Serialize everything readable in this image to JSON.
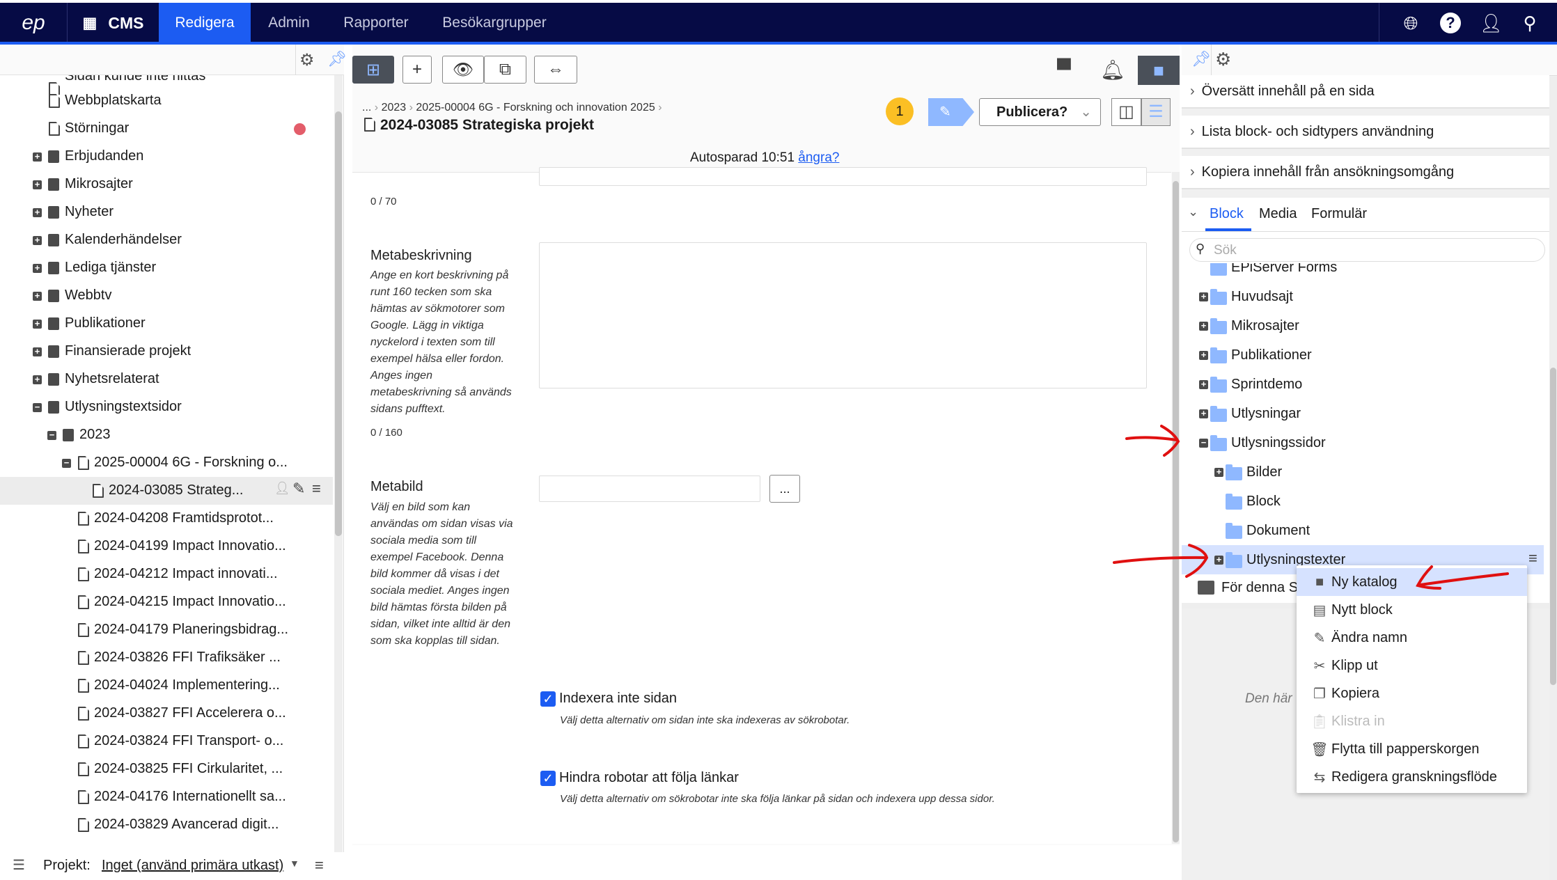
{
  "nav": {
    "logo": "epi",
    "product": "CMS",
    "tabs": [
      {
        "label": "Redigera",
        "active": true
      },
      {
        "label": "Admin"
      },
      {
        "label": "Rapporter"
      },
      {
        "label": "Besökargrupper"
      }
    ],
    "icons": [
      "globe-icon",
      "help-icon",
      "user-icon",
      "search-icon"
    ],
    "accent": "#1c5cf2",
    "background": "#060b45"
  },
  "left_tree": {
    "items": [
      {
        "label": "Sidan kunde inte hittas",
        "level": 0,
        "icon": "page"
      },
      {
        "label": "Webbplatskarta",
        "level": 0,
        "icon": "page"
      },
      {
        "label": "Störningar",
        "level": 0,
        "icon": "page",
        "badge": "clock"
      },
      {
        "label": "Erbjudanden",
        "level": 0,
        "icon": "stack",
        "toggle": "+"
      },
      {
        "label": "Mikrosajter",
        "level": 0,
        "icon": "stack",
        "toggle": "+"
      },
      {
        "label": "Nyheter",
        "level": 0,
        "icon": "stack",
        "toggle": "+"
      },
      {
        "label": "Kalenderhändelser",
        "level": 0,
        "icon": "stack",
        "toggle": "+"
      },
      {
        "label": "Lediga tjänster",
        "level": 0,
        "icon": "stack",
        "toggle": "+"
      },
      {
        "label": "Webbtv",
        "level": 0,
        "icon": "stack",
        "toggle": "+"
      },
      {
        "label": "Publikationer",
        "level": 0,
        "icon": "stack",
        "toggle": "+"
      },
      {
        "label": "Finansierade projekt",
        "level": 0,
        "icon": "stack",
        "toggle": "+"
      },
      {
        "label": "Nyhetsrelaterat",
        "level": 0,
        "icon": "stack",
        "toggle": "+"
      },
      {
        "label": "Utlysningstextsidor",
        "level": 0,
        "icon": "stack",
        "toggle": "-"
      },
      {
        "label": "2023",
        "level": 1,
        "icon": "stack",
        "toggle": "-"
      },
      {
        "label": "2025-00004 6G - Forskning o...",
        "level": 2,
        "icon": "page",
        "toggle": "-"
      },
      {
        "label": "2024-03085 Strateg...",
        "level": 3,
        "icon": "page",
        "selected": true
      },
      {
        "label": "2024-04208 Framtidsprotot...",
        "level": 2,
        "icon": "page"
      },
      {
        "label": "2024-04199 Impact Innovatio...",
        "level": 2,
        "icon": "page"
      },
      {
        "label": "2024-04212 Impact innovati...",
        "level": 2,
        "icon": "page"
      },
      {
        "label": "2024-04215 Impact Innovatio...",
        "level": 2,
        "icon": "page"
      },
      {
        "label": "2024-04179 Planeringsbidrag...",
        "level": 2,
        "icon": "page"
      },
      {
        "label": "2024-03826 FFI Trafiksäker ...",
        "level": 2,
        "icon": "page"
      },
      {
        "label": "2024-04024 Implementering...",
        "level": 2,
        "icon": "page"
      },
      {
        "label": "2024-03827 FFI Accelerera o...",
        "level": 2,
        "icon": "page"
      },
      {
        "label": "2024-03824 FFI Transport- o...",
        "level": 2,
        "icon": "page"
      },
      {
        "label": "2024-03825 FFI Cirkularitet, ...",
        "level": 2,
        "icon": "page"
      },
      {
        "label": "2024-04176 Internationellt sa...",
        "level": 2,
        "icon": "page"
      },
      {
        "label": "2024-03829 Avancerad digit...",
        "level": 2,
        "icon": "page"
      }
    ]
  },
  "status_bar": {
    "label": "Projekt:",
    "value": "Inget (använd primära utkast)"
  },
  "editor": {
    "breadcrumb": [
      "...",
      "2023",
      "2025-00004 6G - Forskning och innovation 2025"
    ],
    "title": "2024-03085 Strategiska projekt",
    "notification_count": "1",
    "publish_label": "Publicera?",
    "autosave_text": "Autosparad 10:51",
    "undo_link": "ångra?",
    "title_count": "0 / 70",
    "meta_description": {
      "label": "Metabeskrivning",
      "help": [
        "Ange en kort beskrivning på",
        "runt 160 tecken som ska",
        "hämtas av sökmotorer som",
        "Google. Lägg in viktiga",
        "nyckelord i texten som till",
        "exempel hälsa eller fordon.",
        "Anges ingen",
        "metabeskrivning så används",
        "sidans pufftext."
      ],
      "count": "0 / 160",
      "value": ""
    },
    "meta_image": {
      "label": "Metabild",
      "help": [
        "Välj en bild som kan",
        "användas om sidan visas via",
        "sociala media som till",
        "exempel Facebook. Denna",
        "bild kommer då visas i det",
        "sociala mediet. Anges ingen",
        "bild hämtas första bilden på",
        "sidan, vilket inte alltid är den",
        "som ska kopplas till sidan."
      ],
      "browse_label": "...",
      "value": ""
    },
    "noindex": {
      "label": "Indexera inte sidan",
      "help": "Välj detta alternativ om sidan inte ska indexeras av sökrobotar.",
      "checked": true
    },
    "nofollow": {
      "label": "Hindra robotar att följa länkar",
      "help": "Välj detta alternativ om sökrobotar inte ska följa länkar på sidan och indexera upp dessa sidor.",
      "checked": true
    }
  },
  "right_panel": {
    "sections": [
      "Översätt innehåll på en sida",
      "Lista block- och sidtypers användning",
      "Kopiera innehåll från ansökningsomgång"
    ],
    "tabs": [
      {
        "label": "Block",
        "active": true
      },
      {
        "label": "Media"
      },
      {
        "label": "Formulär"
      }
    ],
    "search_placeholder": "Sök",
    "tree": [
      {
        "label": "EPiServer Forms",
        "level": 0
      },
      {
        "label": "Huvudsajt",
        "level": 0,
        "toggle": "+"
      },
      {
        "label": "Mikrosajter",
        "level": 0,
        "toggle": "+"
      },
      {
        "label": "Publikationer",
        "level": 0,
        "toggle": "+"
      },
      {
        "label": "Sprintdemo",
        "level": 0,
        "toggle": "+"
      },
      {
        "label": "Utlysningar",
        "level": 0,
        "toggle": "+"
      },
      {
        "label": "Utlysningssidor",
        "level": 0,
        "toggle": "-"
      },
      {
        "label": "Bilder",
        "level": 1,
        "toggle": "+"
      },
      {
        "label": "Block",
        "level": 1
      },
      {
        "label": "Dokument",
        "level": 1
      },
      {
        "label": "Utlysningstexter",
        "level": 1,
        "toggle": "+",
        "selected": true
      }
    ],
    "for_this_site": "För denna Si",
    "empty_text": "Den här"
  },
  "context_menu": {
    "items": [
      {
        "label": "Ny katalog",
        "icon": "folder-icon",
        "highlighted": true
      },
      {
        "label": "Nytt block",
        "icon": "block-icon"
      },
      {
        "label": "Ändra namn",
        "icon": "rename-icon"
      },
      {
        "label": "Klipp ut",
        "icon": "scissors-icon"
      },
      {
        "label": "Kopiera",
        "icon": "copy-icon"
      },
      {
        "label": "Klistra in",
        "icon": "paste-icon",
        "disabled": true
      },
      {
        "label": "Flytta till papperskorgen",
        "icon": "trash-icon"
      },
      {
        "label": "Redigera granskningsflöde",
        "icon": "workflow-icon"
      }
    ]
  }
}
